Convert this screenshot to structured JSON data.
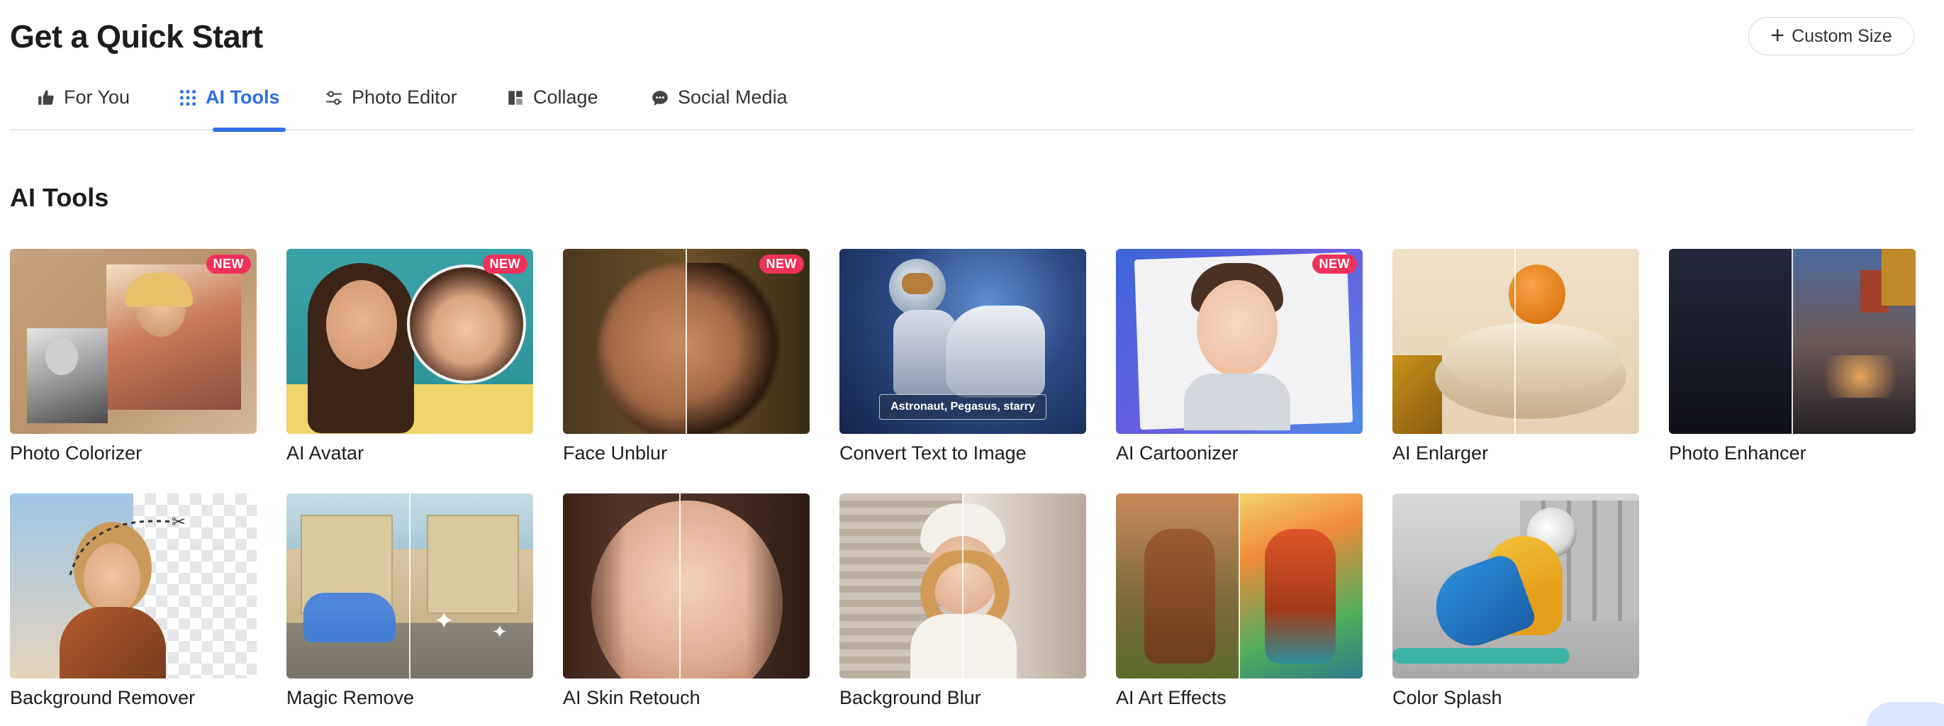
{
  "header": {
    "title": "Get a Quick Start",
    "custom_size_label": "Custom Size"
  },
  "tabs": [
    {
      "label": "For You",
      "icon": "thumbs-up-icon",
      "active": false
    },
    {
      "label": "AI Tools",
      "icon": "grid-dots-icon",
      "active": true
    },
    {
      "label": "Photo Editor",
      "icon": "sliders-icon",
      "active": false
    },
    {
      "label": "Collage",
      "icon": "collage-icon",
      "active": false
    },
    {
      "label": "Social Media",
      "icon": "chat-bubbles-icon",
      "active": false
    }
  ],
  "section": {
    "title": "AI Tools"
  },
  "tools": [
    {
      "label": "Photo Colorizer",
      "badge": "NEW"
    },
    {
      "label": "AI Avatar",
      "badge": "NEW"
    },
    {
      "label": "Face Unblur",
      "badge": "NEW"
    },
    {
      "label": "Convert Text to Image",
      "prompt": "Astronaut, Pegasus, starry"
    },
    {
      "label": "AI Cartoonizer",
      "badge": "NEW"
    },
    {
      "label": "AI Enlarger"
    },
    {
      "label": "Photo Enhancer"
    },
    {
      "label": "Background Remover"
    },
    {
      "label": "Magic Remove"
    },
    {
      "label": "AI Skin Retouch"
    },
    {
      "label": "Background Blur"
    },
    {
      "label": "AI Art Effects"
    },
    {
      "label": "Color Splash"
    }
  ],
  "colors": {
    "accent": "#2f6fe5",
    "badge": "#f0325a",
    "text": "#1d1d1f"
  }
}
